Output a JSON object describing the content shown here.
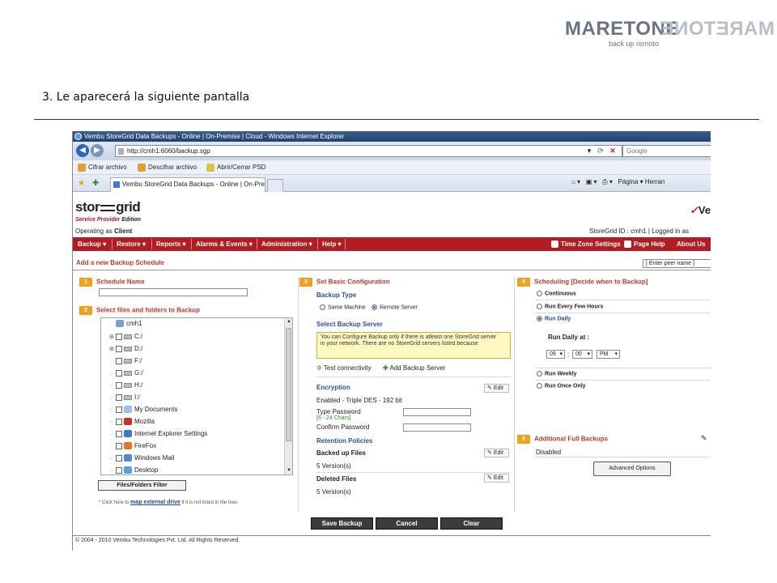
{
  "doc": {
    "logo_text": "MARETONE",
    "logo_tagline": "back up remoto",
    "step_text": "3. Le aparecerá la siguiente pantalla"
  },
  "browser": {
    "title": "Vembu StoreGrid Data Backups - Online | On-Premise | Cloud - Windows Internet Explorer",
    "url": "http://cmh1:6060/backup.sgp",
    "search_placeholder": "Google",
    "security_items": [
      "Cifrar archivo",
      "Descifrar archivo",
      "Abrir/Cerrar PSD"
    ],
    "tab_title": "Vembu StoreGrid Data Backups - Online | On-Pre...",
    "tab_tools": "Página ▾  Herran"
  },
  "app": {
    "logo_left": "stor",
    "logo_right": "grid",
    "edition_label": "Service Provider",
    "edition_word": "Edition",
    "operating_label": "Operating as",
    "operating_value": "Client",
    "vembu": "Ve",
    "storegrid_id": "StoreGrid ID : cmh1  |  Logged in as",
    "menu": [
      "Backup ▾",
      "Restore ▾",
      "Reports ▾",
      "Alarms & Events ▾",
      "Administration ▾",
      "Help ▾"
    ],
    "menu_right": [
      "Time Zone Settings",
      "Page Help",
      "About Us"
    ],
    "page_heading": "Add a new Backup Schedule",
    "peer_select": "[ Enter peer name ]"
  },
  "left": {
    "step1_num": "1",
    "step1_title": "Schedule Name",
    "step2_num": "2",
    "step2_title": "Select files and folders to Backup",
    "tree": [
      {
        "exp": "",
        "label": "cmh1",
        "kind": "pc"
      },
      {
        "exp": "⊞",
        "label": "C:/",
        "kind": "drive"
      },
      {
        "exp": "⊞",
        "label": "D:/",
        "kind": "drive"
      },
      {
        "exp": "",
        "label": "F:/",
        "kind": "drive"
      },
      {
        "exp": "··",
        "label": "G:/",
        "kind": "drive"
      },
      {
        "exp": "··",
        "label": "H:/",
        "kind": "drive"
      },
      {
        "exp": "··",
        "label": "I:/",
        "kind": "drive"
      },
      {
        "exp": "··",
        "label": "My Documents",
        "kind": "docs"
      },
      {
        "exp": "··",
        "label": "Mozilla",
        "kind": "mozilla"
      },
      {
        "exp": "··",
        "label": "Internet Explorer Settings",
        "kind": "ie"
      },
      {
        "exp": "",
        "label": "FireFox",
        "kind": "firefox"
      },
      {
        "exp": "··",
        "label": "Windows Mail",
        "kind": "mail"
      },
      {
        "exp": "··",
        "label": "Desktop",
        "kind": "desktop"
      }
    ],
    "filter_button": "Files/Folders Filter",
    "map_note_prefix": "* Click here to",
    "map_link": "map external drive",
    "map_note_suffix": "if it is not listed in the tree."
  },
  "middle": {
    "step3_num": "3",
    "step3_title": "Set Basic Configuration",
    "backup_type_label": "Backup Type",
    "opt_same_machine": "Same Machine",
    "opt_remote_server": "Remote Server",
    "select_server_label": "Select Backup Server",
    "info_text": "You can Configure Backup only if there is atleast one StoreGrid server in your network. There are no StoreGrid servers listed because",
    "test_connectivity": "Test connectivity",
    "add_backup_server": "Add Backup Server",
    "encryption_label": "Encryption",
    "encryption_value": "Enabled - Triple DES - 192 bit",
    "type_password": "Type Password",
    "password_hint": "[6 - 24 Chars]",
    "confirm_password": "Confirm Password",
    "retention_label": "Retention Policies",
    "backed_up_files": "Backed up Files",
    "backed_up_value": "5   Version(s)",
    "deleted_files": "Deleted Files",
    "deleted_value": "5   Version(s)",
    "edit": "Edit"
  },
  "right": {
    "step4_num": "4",
    "step4_title": "Scheduling [Decide when to Backup]",
    "opt_continuous": "Continuous",
    "opt_every_few_hours": "Run Every Few Hours",
    "opt_daily": "Run Daily",
    "run_daily_at": "Run Daily at :",
    "hour": "09",
    "minute": "00",
    "ampm": "PM",
    "time_sep": ":",
    "opt_weekly": "Run Weekly",
    "opt_once_only": "Run Once Only",
    "step5_num": "5",
    "step5_title": "Additional Full Backups",
    "full_backups_value": "Disabled",
    "advanced_options": "Advanced Options"
  },
  "actions": [
    "Save Backup",
    "Cancel",
    "Clear"
  ],
  "footer": "© 2004 - 2010 Vembu Technologies Pvt. Ltd. All Rights Reserved."
}
